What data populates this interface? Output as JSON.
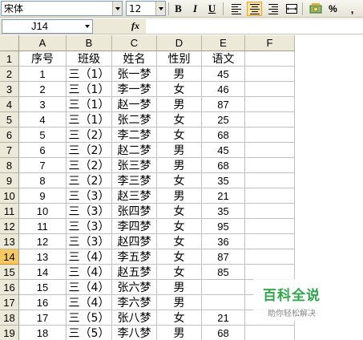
{
  "toolbar": {
    "font_name": "宋体",
    "font_size": "12",
    "bold_label": "B",
    "italic_label": "I",
    "underline_label": "U",
    "percent_label": "%",
    "comma_label": ","
  },
  "formula_bar": {
    "name_box": "J14",
    "fx_label": "fx",
    "formula": ""
  },
  "columns": [
    "A",
    "B",
    "C",
    "D",
    "E",
    "F"
  ],
  "header_row": [
    "序号",
    "班级",
    "姓名",
    "性别",
    "语文"
  ],
  "data_rows": [
    [
      "1",
      "三（1）",
      "张一梦",
      "男",
      "45"
    ],
    [
      "2",
      "三（1）",
      "李一梦",
      "女",
      "46"
    ],
    [
      "3",
      "三（1）",
      "赵一梦",
      "男",
      "87"
    ],
    [
      "4",
      "三（1）",
      "张二梦",
      "女",
      "25"
    ],
    [
      "5",
      "三（2）",
      "李二梦",
      "女",
      "68"
    ],
    [
      "6",
      "三（2）",
      "赵二梦",
      "男",
      "45"
    ],
    [
      "7",
      "三（2）",
      "张三梦",
      "男",
      "68"
    ],
    [
      "8",
      "三（2）",
      "李三梦",
      "女",
      "35"
    ],
    [
      "9",
      "三（3）",
      "赵三梦",
      "男",
      "21"
    ],
    [
      "10",
      "三（3）",
      "张四梦",
      "女",
      "35"
    ],
    [
      "11",
      "三（3）",
      "李四梦",
      "女",
      "95"
    ],
    [
      "12",
      "三（3）",
      "赵四梦",
      "女",
      "36"
    ],
    [
      "13",
      "三（4）",
      "李五梦",
      "女",
      "87"
    ],
    [
      "14",
      "三（4）",
      "赵五梦",
      "女",
      "85"
    ],
    [
      "15",
      "三（4）",
      "张六梦",
      "男",
      ""
    ],
    [
      "16",
      "三（4）",
      "李六梦",
      "男",
      ""
    ],
    [
      "17",
      "三（5）",
      "张八梦",
      "女",
      "21"
    ],
    [
      "18",
      "三（5）",
      "李八梦",
      "男",
      "68"
    ]
  ],
  "row_numbers": [
    "1",
    "2",
    "3",
    "4",
    "5",
    "6",
    "7",
    "8",
    "9",
    "10",
    "11",
    "12",
    "13",
    "14",
    "15",
    "16",
    "17",
    "18",
    "19"
  ],
  "active_row_index": 13,
  "watermark": {
    "title": "百科全说",
    "subtitle": "助你轻松解决"
  },
  "colors": {
    "active_row_header": "#f8c860",
    "watermark_green": "#2ea84a",
    "toolbar_bg": "#ece9d8"
  }
}
